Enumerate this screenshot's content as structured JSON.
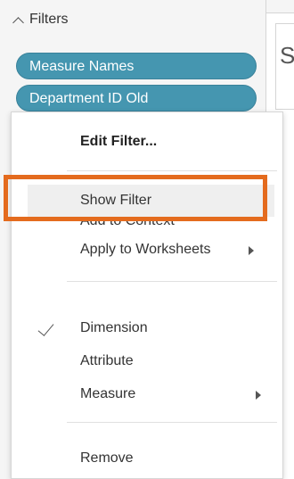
{
  "filters_panel": {
    "header_label": "Filters",
    "pills": [
      "Measure Names",
      "Department ID Old"
    ]
  },
  "sheet": {
    "letter": "S"
  },
  "context_menu": {
    "items": {
      "edit_filter": "Edit Filter...",
      "show_filter": "Show Filter",
      "add_to_context": "Add to Context",
      "apply_to_worksheets": "Apply to Worksheets",
      "dimension": "Dimension",
      "attribute": "Attribute",
      "measure": "Measure",
      "remove": "Remove"
    },
    "checked_item": "Dimension",
    "highlighted_item": "Show Filter"
  },
  "colors": {
    "pill_fill": "#4596b0",
    "highlight_border": "#e46b1e",
    "highlight_fill": "#efefef"
  }
}
